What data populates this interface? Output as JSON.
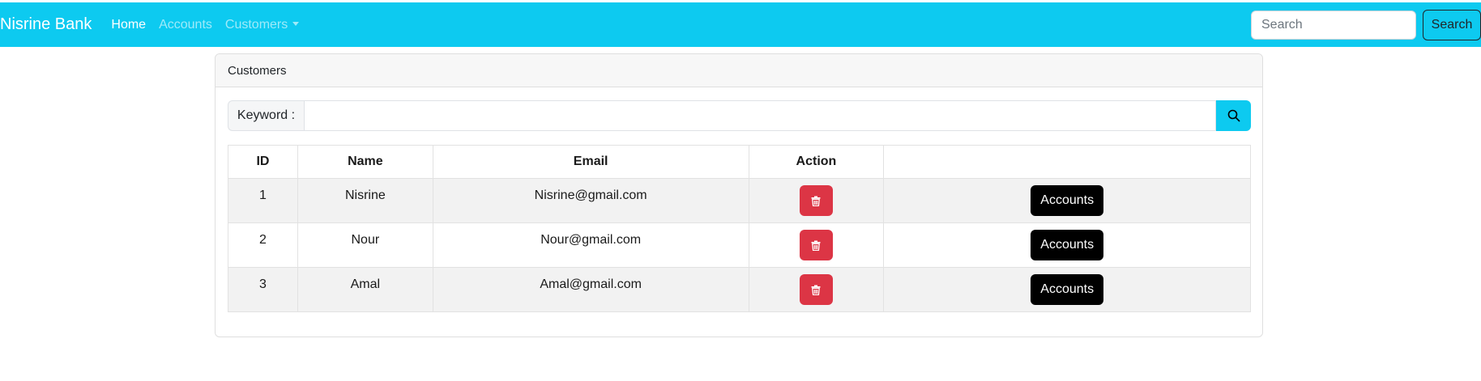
{
  "navbar": {
    "brand": "Nisrine Bank",
    "links": [
      {
        "label": "Home",
        "active": true
      },
      {
        "label": "Accounts",
        "active": false
      },
      {
        "label": "Customers",
        "active": false
      }
    ],
    "search_placeholder": "Search",
    "search_button": "Search",
    "bg_color": "#0dcaf0"
  },
  "card": {
    "header": "Customers",
    "keyword_label": "Keyword :",
    "keyword_value": "",
    "search_icon": "search-icon"
  },
  "table": {
    "columns": [
      "ID",
      "Name",
      "Email",
      "Action",
      ""
    ],
    "rows": [
      {
        "id": "1",
        "name": "Nisrine",
        "email": "Nisrine@gmail.com",
        "delete_icon": "trash-icon",
        "accounts_label": "Accounts"
      },
      {
        "id": "2",
        "name": "Nour",
        "email": "Nour@gmail.com",
        "delete_icon": "trash-icon",
        "accounts_label": "Accounts"
      },
      {
        "id": "3",
        "name": "Amal",
        "email": "Amal@gmail.com",
        "delete_icon": "trash-icon",
        "accounts_label": "Accounts"
      }
    ]
  },
  "colors": {
    "accent": "#0dcaf0",
    "danger": "#dc3545",
    "dark": "#000000"
  }
}
